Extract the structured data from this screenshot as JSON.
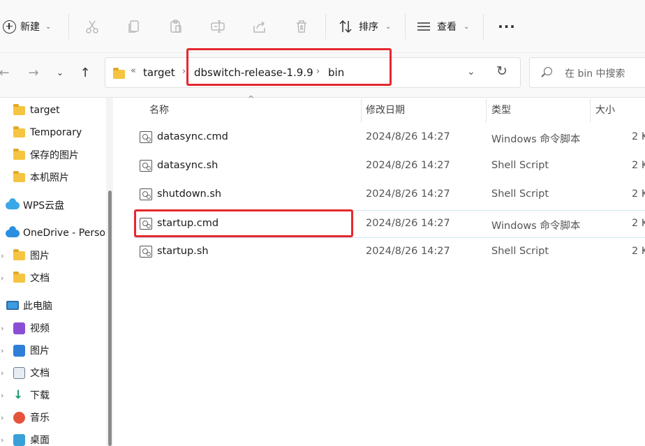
{
  "toolbar": {
    "new_label": "新建",
    "sort_label": "排序",
    "view_label": "查看",
    "more_label": "···"
  },
  "address": {
    "overflow": "«",
    "crumbs": [
      "target",
      "dbswitch-release-1.9.9",
      "bin"
    ],
    "separator": "›"
  },
  "search": {
    "placeholder": "在 bin 中搜索"
  },
  "sidebar": {
    "items": [
      {
        "label": "target"
      },
      {
        "label": "Temporary"
      },
      {
        "label": "保存的图片"
      },
      {
        "label": "本机照片"
      },
      {
        "label": "WPS云盘"
      },
      {
        "label": "OneDrive - Perso"
      },
      {
        "label": "图片"
      },
      {
        "label": "文档"
      },
      {
        "label": "此电脑"
      },
      {
        "label": "视频"
      },
      {
        "label": "图片"
      },
      {
        "label": "文档"
      },
      {
        "label": "下载"
      },
      {
        "label": "音乐"
      },
      {
        "label": "桌面"
      }
    ]
  },
  "columns": {
    "name": "名称",
    "date": "修改日期",
    "type": "类型",
    "size": "大小"
  },
  "files": [
    {
      "name": "datasync.cmd",
      "date": "2024/8/26 14:27",
      "type": "Windows 命令脚本",
      "size": "2 K"
    },
    {
      "name": "datasync.sh",
      "date": "2024/8/26 14:27",
      "type": "Shell Script",
      "size": "2 K"
    },
    {
      "name": "shutdown.sh",
      "date": "2024/8/26 14:27",
      "type": "Shell Script",
      "size": "2 K"
    },
    {
      "name": "startup.cmd",
      "date": "2024/8/26 14:27",
      "type": "Windows 命令脚本",
      "size": "2 K"
    },
    {
      "name": "startup.sh",
      "date": "2024/8/26 14:27",
      "type": "Shell Script",
      "size": "2 K"
    }
  ],
  "colors": {
    "highlight": "#e5282d",
    "folder": "#f5c542",
    "selection_border": "#cde6f7"
  }
}
